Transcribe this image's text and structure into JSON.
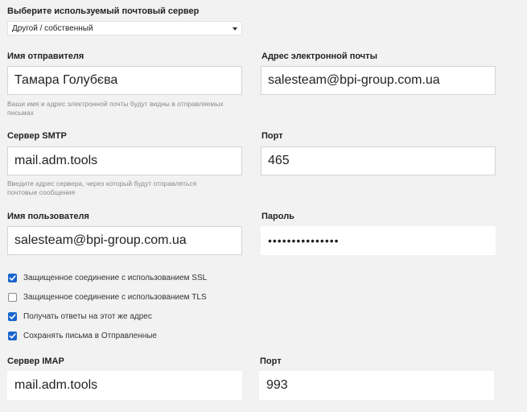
{
  "server": {
    "label": "Выберите используемый почтовый сервер",
    "selected": "Другой / собственный"
  },
  "sender": {
    "name_label": "Имя отправителя",
    "name_value": "Тамара Голубєва",
    "email_label": "Адрес электронной почты",
    "email_value": "salesteam@bpi-group.com.ua",
    "hint_line1": "Ваши имя и адрес электронной почты будут видны в отправляемых",
    "hint_line2": "письмах"
  },
  "smtp": {
    "label": "Сервер SMTP",
    "value": "mail.adm.tools",
    "port_label": "Порт",
    "port_value": "465",
    "hint_line1": "Введите адрес сервера, через который будут отправляться",
    "hint_line2": "почтовые сообщения"
  },
  "auth": {
    "user_label": "Имя пользователя",
    "user_value": "salesteam@bpi-group.com.ua",
    "password_label": "Пароль",
    "password_mask": "•••••••••••••••"
  },
  "options": [
    {
      "label": "Защищенное соединение с использованием SSL",
      "checked": true
    },
    {
      "label": "Защищенное соединение с использованием TLS",
      "checked": false
    },
    {
      "label": "Получать ответы на этот же адрес",
      "checked": true
    },
    {
      "label": "Сохранять письма в Отправленные",
      "checked": true
    }
  ],
  "imap": {
    "label": "Сервер IMAP",
    "value": "mail.adm.tools",
    "port_label": "Порт",
    "port_value": "993"
  },
  "colors": {
    "checkbox_accent": "#1a66cc"
  }
}
